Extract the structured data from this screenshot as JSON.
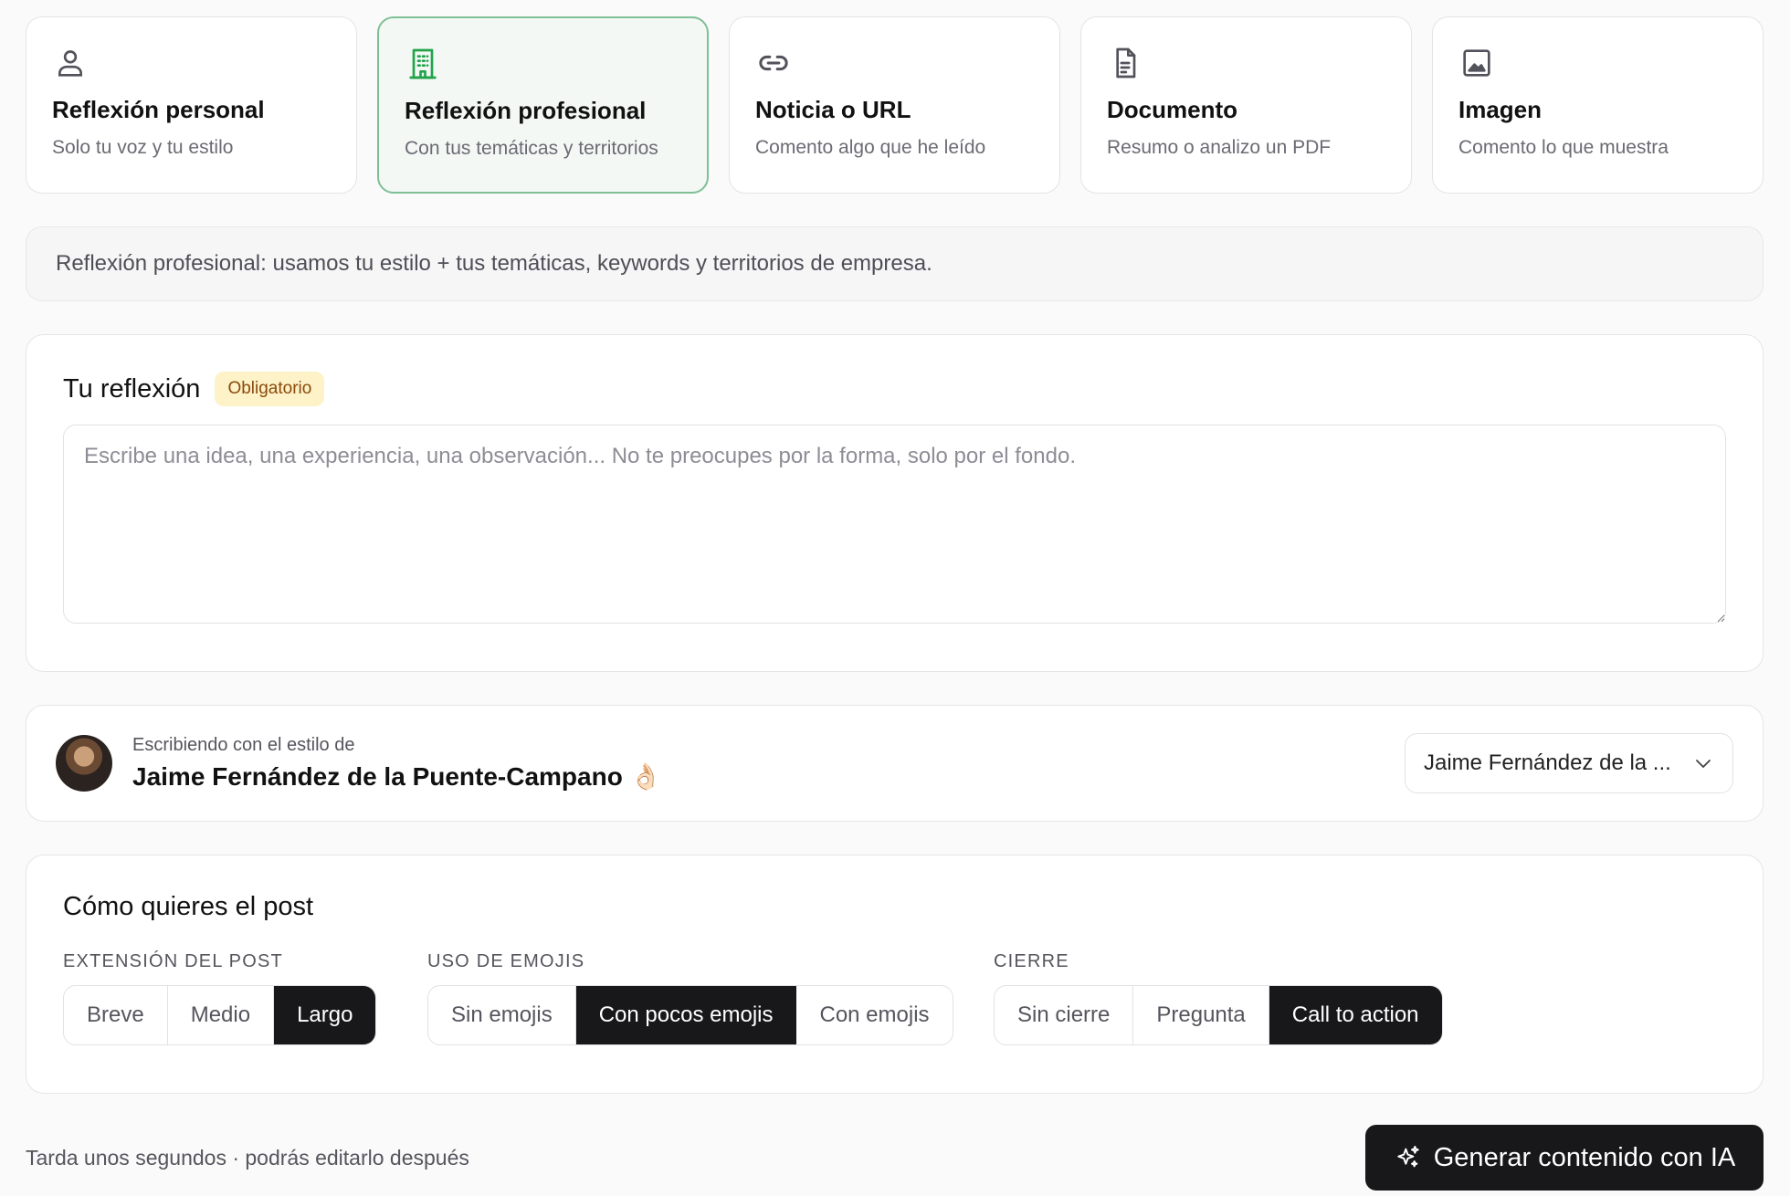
{
  "modes": [
    {
      "title": "Reflexión personal",
      "subtitle": "Solo tu voz y tu estilo",
      "icon": "user-icon",
      "active": false
    },
    {
      "title": "Reflexión profesional",
      "subtitle": "Con tus temáticas y territorios",
      "icon": "building-icon",
      "active": true
    },
    {
      "title": "Noticia o URL",
      "subtitle": "Comento algo que he leído",
      "icon": "link-icon",
      "active": false
    },
    {
      "title": "Documento",
      "subtitle": "Resumo o analizo un PDF",
      "icon": "document-icon",
      "active": false
    },
    {
      "title": "Imagen",
      "subtitle": "Comento lo que muestra",
      "icon": "image-icon",
      "active": false
    }
  ],
  "info": "Reflexión profesional: usamos tu estilo + tus temáticas, keywords y territorios de empresa.",
  "reflection": {
    "title": "Tu reflexión",
    "badge": "Obligatorio",
    "placeholder": "Escribe una idea, una experiencia, una observación... No te preocupes por la forma, solo por el fondo.",
    "value": ""
  },
  "style": {
    "label": "Escribiendo con el estilo de",
    "name": "Jaime Fernández de la Puente-Campano 👌🏻",
    "selected": "Jaime Fernández de la ..."
  },
  "post_options": {
    "title": "Cómo quieres el post",
    "length": {
      "label": "Extensión del post",
      "options": [
        "Breve",
        "Medio",
        "Largo"
      ],
      "selected": "Largo"
    },
    "emojis": {
      "label": "Uso de emojis",
      "options": [
        "Sin emojis",
        "Con pocos emojis",
        "Con emojis"
      ],
      "selected": "Con pocos emojis"
    },
    "closing": {
      "label": "Cierre",
      "options": [
        "Sin cierre",
        "Pregunta",
        "Call to action"
      ],
      "selected": "Call to action"
    }
  },
  "footer": {
    "hint": "Tarda unos segundos · podrás editarlo después",
    "generate_label": "Generar contenido con IA"
  },
  "colors": {
    "accent": "#22a34a",
    "active_border": "#7fbf96",
    "dark": "#18181b",
    "badge_bg": "#fdf2c8"
  }
}
